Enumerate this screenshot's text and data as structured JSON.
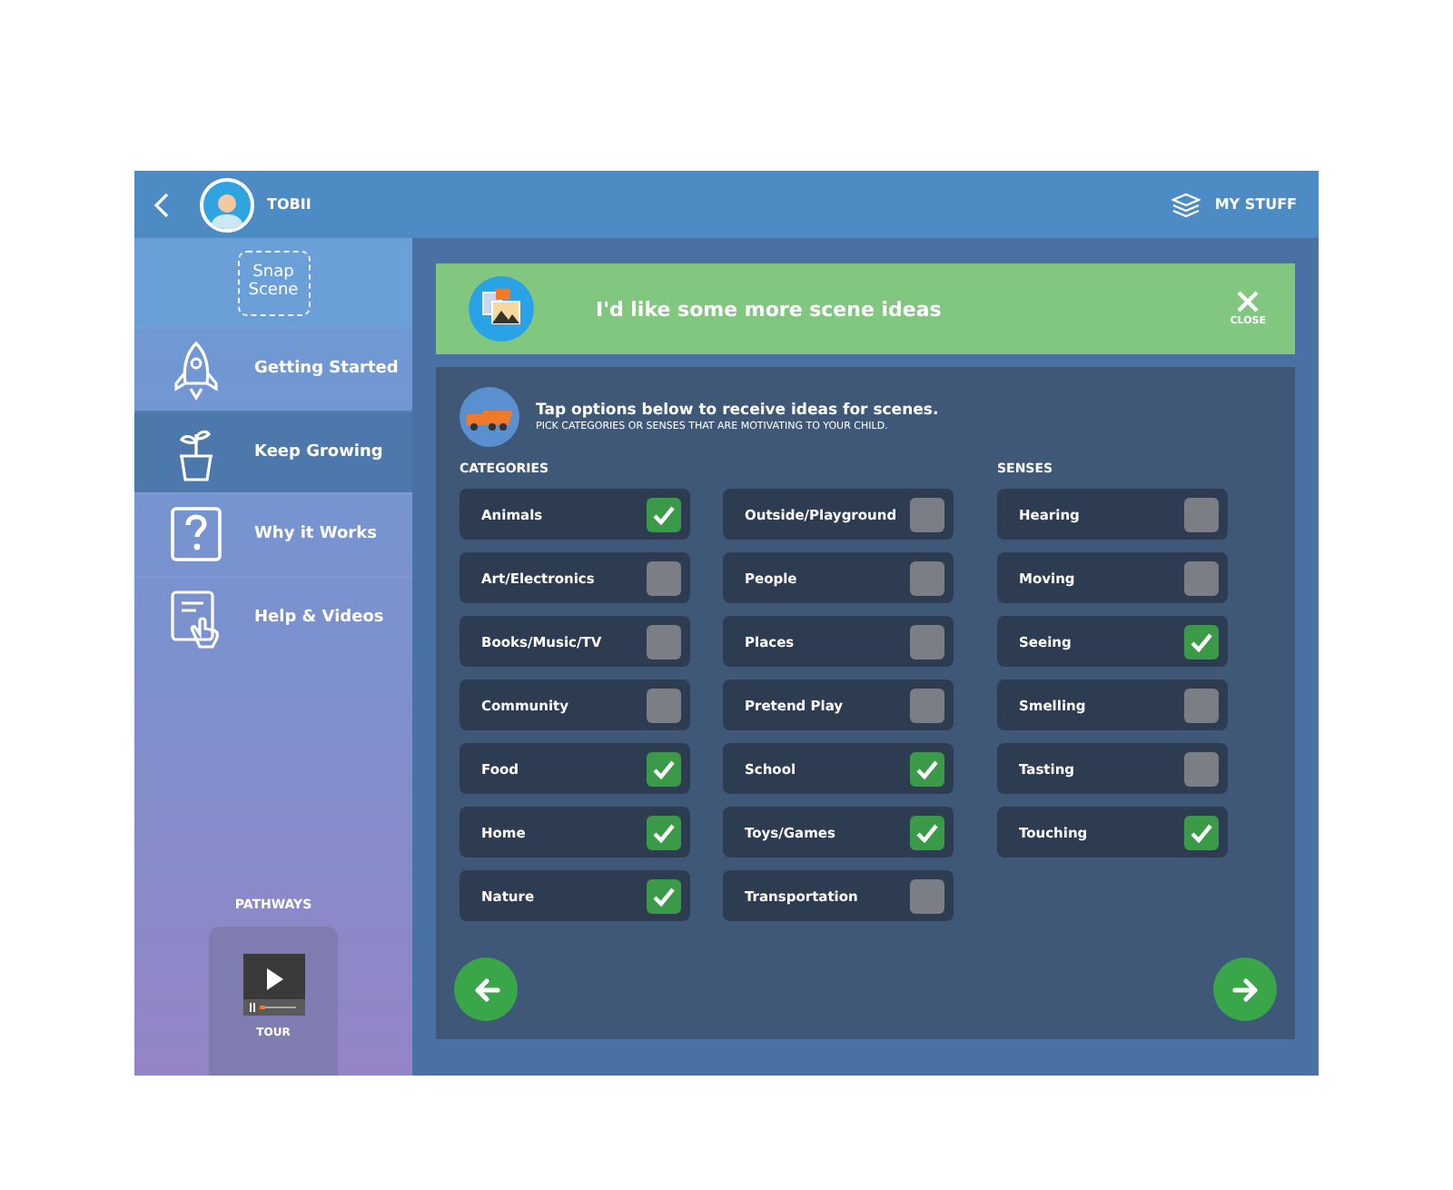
{
  "header": {
    "user_name": "TOBII",
    "my_stuff": "MY STUFF"
  },
  "sidebar": {
    "logo": [
      "Snap",
      "Scene"
    ],
    "items": [
      {
        "label": "Getting Started",
        "selected": false
      },
      {
        "label": "Keep Growing",
        "selected": true
      },
      {
        "label": "Why it Works",
        "selected": false
      },
      {
        "label": "Help & Videos",
        "selected": false
      }
    ],
    "pathways_title": "PATHWAYS",
    "tour_label": "TOUR"
  },
  "banner": {
    "title": "I'd like some more scene ideas",
    "close_label": "CLOSE"
  },
  "panel": {
    "instruction": "Tap options below to receive ideas for scenes.",
    "hint": "PICK CATEGORIES OR SENSES THAT ARE MOTIVATING TO YOUR CHILD.",
    "groups": [
      {
        "title": "CATEGORIES",
        "columns": [
          [
            {
              "label": "Animals",
              "checked": true
            },
            {
              "label": "Art/Electronics",
              "checked": false
            },
            {
              "label": "Books/Music/TV",
              "checked": false
            },
            {
              "label": "Community",
              "checked": false
            },
            {
              "label": "Food",
              "checked": true
            },
            {
              "label": "Home",
              "checked": true
            },
            {
              "label": "Nature",
              "checked": true
            }
          ],
          [
            {
              "label": "Outside/Playground",
              "checked": false
            },
            {
              "label": "People",
              "checked": false
            },
            {
              "label": "Places",
              "checked": false
            },
            {
              "label": "Pretend Play",
              "checked": false
            },
            {
              "label": "School",
              "checked": true
            },
            {
              "label": "Toys/Games",
              "checked": true
            },
            {
              "label": "Transportation",
              "checked": false
            }
          ]
        ]
      },
      {
        "title": "SENSES",
        "columns": [
          [
            {
              "label": "Hearing",
              "checked": false
            },
            {
              "label": "Moving",
              "checked": false
            },
            {
              "label": "Seeing",
              "checked": true
            },
            {
              "label": "Smelling",
              "checked": false
            },
            {
              "label": "Tasting",
              "checked": false
            },
            {
              "label": "Touching",
              "checked": true
            }
          ]
        ]
      }
    ]
  }
}
